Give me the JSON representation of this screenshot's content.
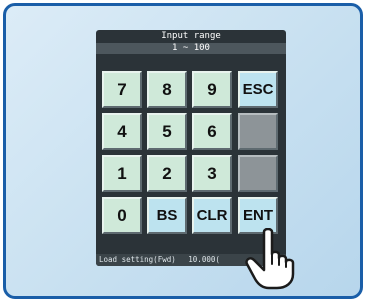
{
  "header": {
    "title": "Input range",
    "range": "1 ~ 100"
  },
  "keypad": {
    "k7": "7",
    "k8": "8",
    "k9": "9",
    "esc": "ESC",
    "k4": "4",
    "k5": "5",
    "k6": "6",
    "k1": "1",
    "k2": "2",
    "k3": "3",
    "k0": "0",
    "bs": "BS",
    "clr": "CLR",
    "ent": "ENT"
  },
  "status": {
    "label": "Load setting(Fwd)",
    "value": "10.000("
  },
  "colors": {
    "frame_border": "#1a5ea8",
    "number_key": "#cfe9d9",
    "function_key": "#bde3ef",
    "blank_key": "#8d9498"
  },
  "icons": {
    "pointer": "pointing-hand-icon"
  }
}
